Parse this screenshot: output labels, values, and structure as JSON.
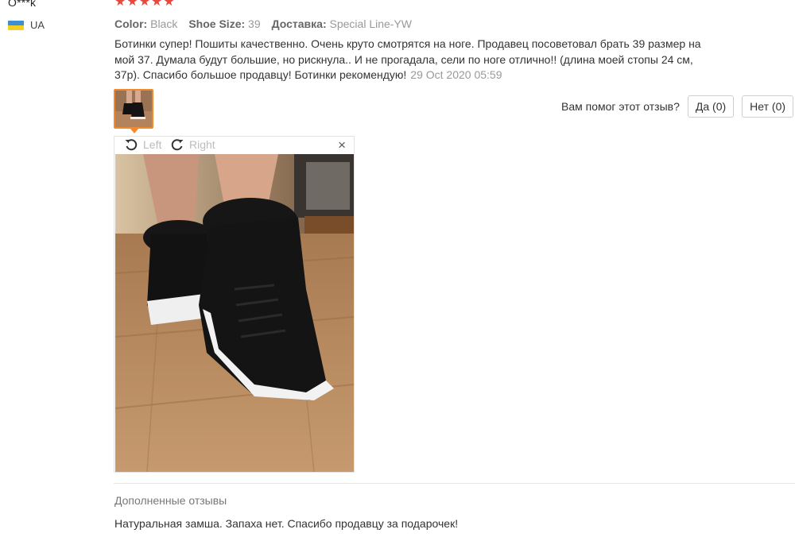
{
  "user": {
    "name": "O***k",
    "country": "UA",
    "flag_colors": [
      "#3d8fd6",
      "#f4d022"
    ]
  },
  "review": {
    "rating": 5,
    "star_color": "#e8493e",
    "attributes": [
      {
        "key": "Color:",
        "value": "Black"
      },
      {
        "key": "Shoe Size:",
        "value": "39"
      },
      {
        "key": "Доставка:",
        "value": "Special Line-YW"
      }
    ],
    "text": "Ботинки супер! Пошиты качественно. Очень круто смотрятся на ноге. Продавец посоветовал брать 39 размер на мой 37. Думала будут большие, но рискнула.. И не прогадала, сели по ноге отлично!! (длина моей стопы 24 см, 37р). Спасибо большое продавцу! Ботинки рекомендую!",
    "date": "29 Oct 2020 05:59"
  },
  "helpful": {
    "question": "Вам помог этот отзыв?",
    "yes_label": "Да (0)",
    "no_label": "Нет (0)"
  },
  "viewer": {
    "rotate_left_label": "Left",
    "rotate_right_label": "Right",
    "close_glyph": "×",
    "photo_icon": "boots-photo"
  },
  "followup": {
    "title": "Дополненные отзывы",
    "text": "Натуральная замша. Запаха нет. Спасибо продавцу за подарочек!"
  },
  "colors": {
    "accent_orange": "#f08a2c",
    "muted_text": "#999999"
  }
}
